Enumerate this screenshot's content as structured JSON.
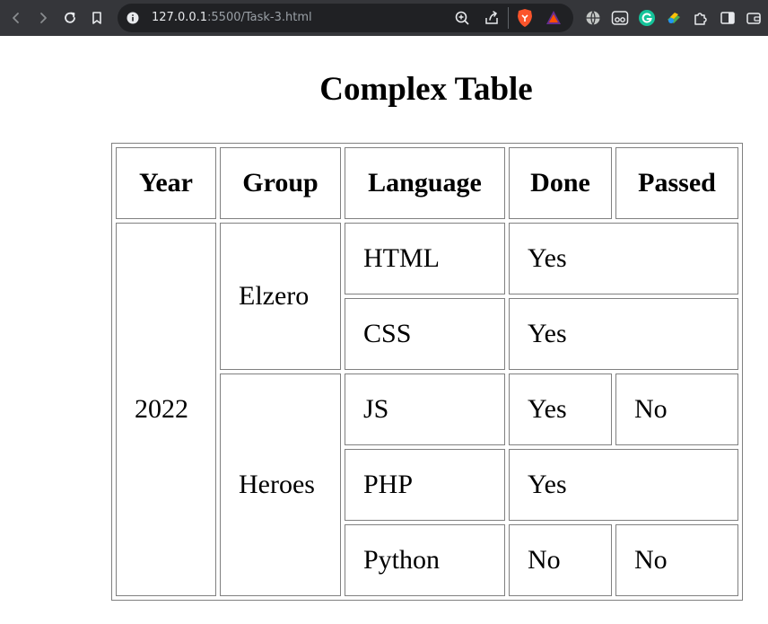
{
  "browser": {
    "url_host": "127.0.0.1",
    "url_rest": ":5500/Task-3.html",
    "icons": [
      "back-icon",
      "forward-icon",
      "reload-icon",
      "bookmark-icon",
      "site-info-icon",
      "zoom-icon",
      "share-icon",
      "brave-shield-icon",
      "brave-rewards-icon",
      "globe-icon",
      "incognito-icon",
      "grammarly-icon",
      "extension-colorful-icon",
      "extensions-puzzle-icon",
      "sidebar-icon",
      "wallet-icon"
    ]
  },
  "page": {
    "title": "Complex Table"
  },
  "table": {
    "headers": [
      "Year",
      "Group",
      "Language",
      "Done",
      "Passed"
    ],
    "year": "2022",
    "groups": [
      "Elzero",
      "Heroes"
    ],
    "rows": [
      {
        "language": "HTML",
        "done": "Yes",
        "passed": ""
      },
      {
        "language": "CSS",
        "done": "Yes",
        "passed": ""
      },
      {
        "language": "JS",
        "done": "Yes",
        "passed": "No"
      },
      {
        "language": "PHP",
        "done": "Yes",
        "passed": ""
      },
      {
        "language": "Python",
        "done": "No",
        "passed": "No"
      }
    ]
  }
}
